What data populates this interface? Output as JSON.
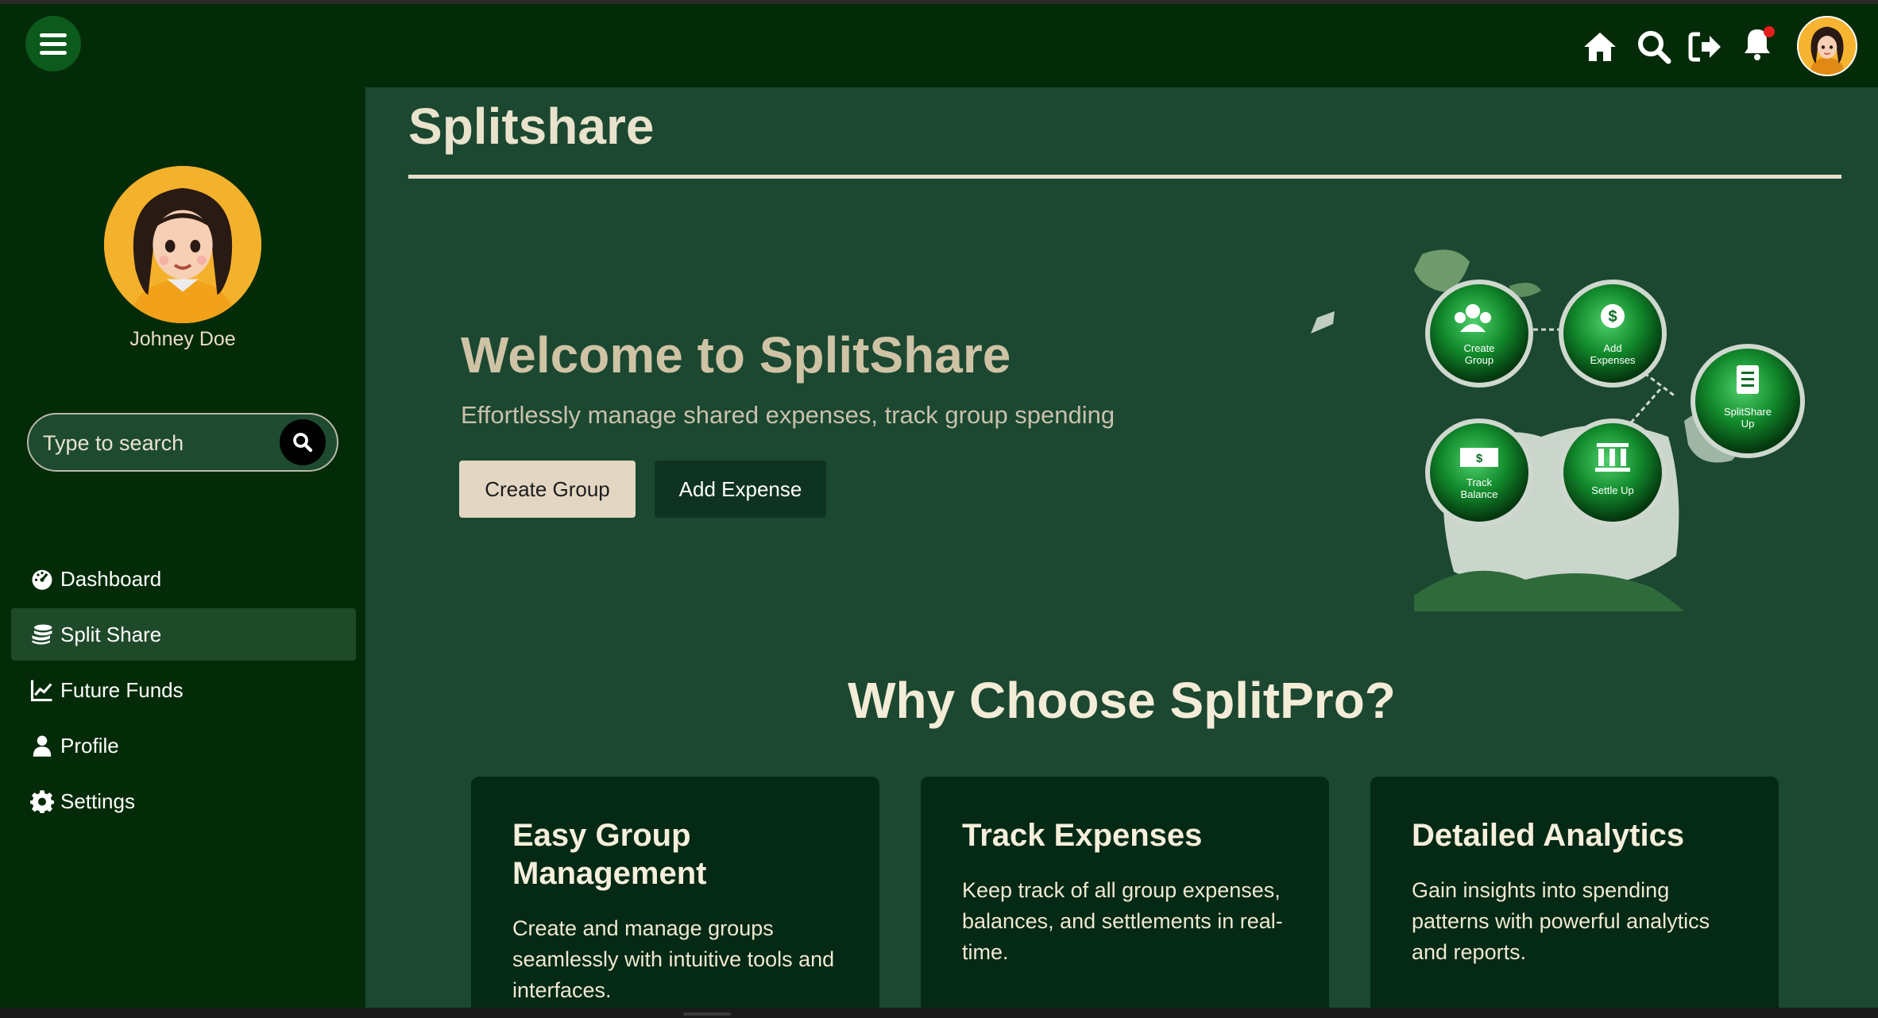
{
  "header": {
    "menu_icon": "hamburger-icon",
    "icons": [
      "home-icon",
      "search-icon",
      "logout-icon",
      "bell-icon"
    ],
    "has_notification": true,
    "avatar_icon": "avatar"
  },
  "sidebar": {
    "user_name": "Johney Doe",
    "search_placeholder": "Type to search",
    "items": [
      {
        "label": "Dashboard",
        "icon": "dashboard-icon",
        "active": false
      },
      {
        "label": "Split Share",
        "icon": "coins-icon",
        "active": true
      },
      {
        "label": "Future Funds",
        "icon": "chart-line-icon",
        "active": false
      },
      {
        "label": "Profile",
        "icon": "user-icon",
        "active": false
      },
      {
        "label": "Settings",
        "icon": "gear-icon",
        "active": false
      }
    ]
  },
  "main": {
    "page_title": "Splitshare",
    "hero": {
      "heading": "Welcome to SplitShare",
      "subheading": "Effortlessly manage shared expenses, track group spending",
      "primary_button": "Create Group",
      "secondary_button": "Add Expense",
      "illustration": {
        "nodes": [
          {
            "label1": "Create",
            "label2": "Group",
            "icon": "group-icon"
          },
          {
            "label1": "Add",
            "label2": "Expenses",
            "icon": "dollar-icon"
          },
          {
            "label1": "SplitShare",
            "label2": "Up",
            "icon": "clipboard-icon"
          },
          {
            "label1": "Track",
            "label2": "Balance",
            "icon": "money-icon"
          },
          {
            "label1": "Settle Up",
            "label2": "",
            "icon": "pillars-icon"
          }
        ]
      }
    },
    "why_title": "Why Choose SplitPro?",
    "cards": [
      {
        "title": "Easy Group Management",
        "text": "Create and manage groups seamlessly with intuitive tools and interfaces."
      },
      {
        "title": "Track Expenses",
        "text": "Keep track of all group expenses, balances, and settlements in real-time."
      },
      {
        "title": "Detailed Analytics",
        "text": "Gain insights into spending patterns with powerful analytics and reports."
      }
    ]
  },
  "colors": {
    "sidebar_bg": "#032b08",
    "main_bg": "#1c4731",
    "card_bg": "#042914",
    "accent_cream": "#e3d6c2",
    "notification": "#e51e1e"
  }
}
